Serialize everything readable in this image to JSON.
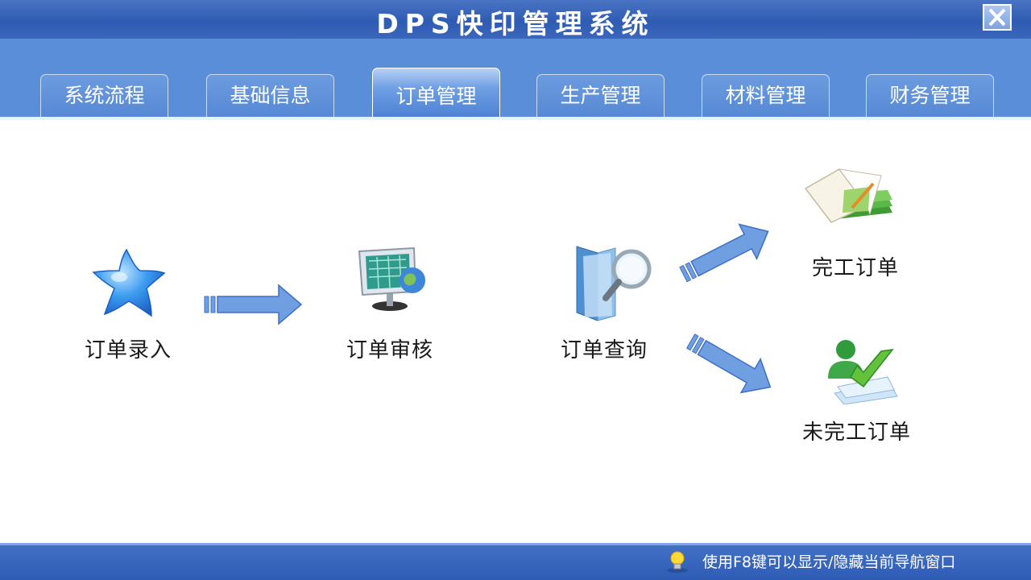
{
  "window": {
    "title": "DPS快印管理系统",
    "close_label": "×"
  },
  "tabs": [
    {
      "label": "系统流程",
      "active": false
    },
    {
      "label": "基础信息",
      "active": false
    },
    {
      "label": "订单管理",
      "active": true
    },
    {
      "label": "生产管理",
      "active": false
    },
    {
      "label": "材料管理",
      "active": false
    },
    {
      "label": "财务管理",
      "active": false
    }
  ],
  "workflow": {
    "order_entry": {
      "label": "订单录入",
      "icon": "star-icon"
    },
    "order_review": {
      "label": "订单审核",
      "icon": "monitor-globe-icon"
    },
    "order_query": {
      "label": "订单查询",
      "icon": "folder-search-icon"
    },
    "completed_orders": {
      "label": "完工订单",
      "icon": "books-icon"
    },
    "incomplete_orders": {
      "label": "未完工订单",
      "icon": "user-check-icon"
    }
  },
  "statusbar": {
    "hint": "使用F8键可以显示/隐藏当前导航窗口",
    "icon": "lightbulb-icon"
  },
  "colors": {
    "titlebar": "#2f5cb3",
    "tabbar": "#5a8ed9",
    "arrow": "#6f9fe0",
    "arrow_stroke": "#3e6fc8"
  }
}
